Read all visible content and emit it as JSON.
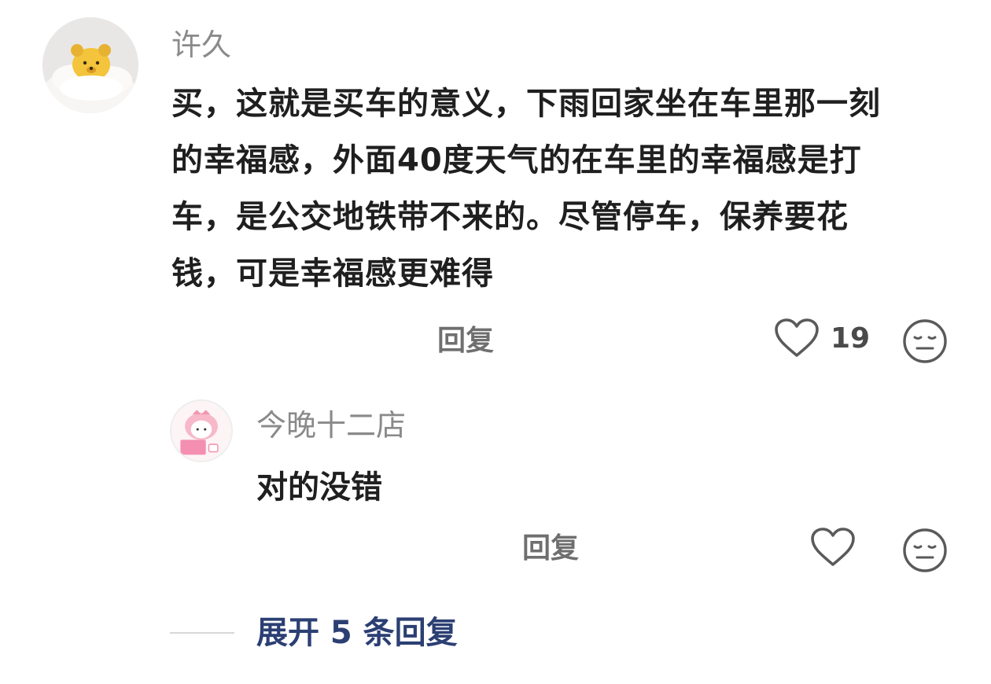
{
  "comment": {
    "username": "许久",
    "text": "买，这就是买车的意义，下雨回家坐在车里那一刻的幸福感，外面40度天气的在车里的幸福感是打车，是公交地铁带不来的。尽管停车，保养要花钱，可是幸福感更难得",
    "reply_label": "回复",
    "like_count": "19",
    "avatar_icon": "winnie-the-pooh-avatar",
    "like_icon": "heart-outline-icon",
    "dislike_icon": "meh-face-icon"
  },
  "reply": {
    "username": "今晚十二店",
    "text": "对的没错",
    "reply_label": "回复",
    "avatar_icon": "pink-cartoon-avatar",
    "like_icon": "heart-outline-icon",
    "dislike_icon": "meh-face-icon"
  },
  "expand": {
    "label": "展开 5 条回复"
  },
  "colors": {
    "username": "#8a8a8a",
    "text": "#1f1f1f",
    "secondary": "#6f6f6f",
    "expand": "#2b3f73"
  }
}
